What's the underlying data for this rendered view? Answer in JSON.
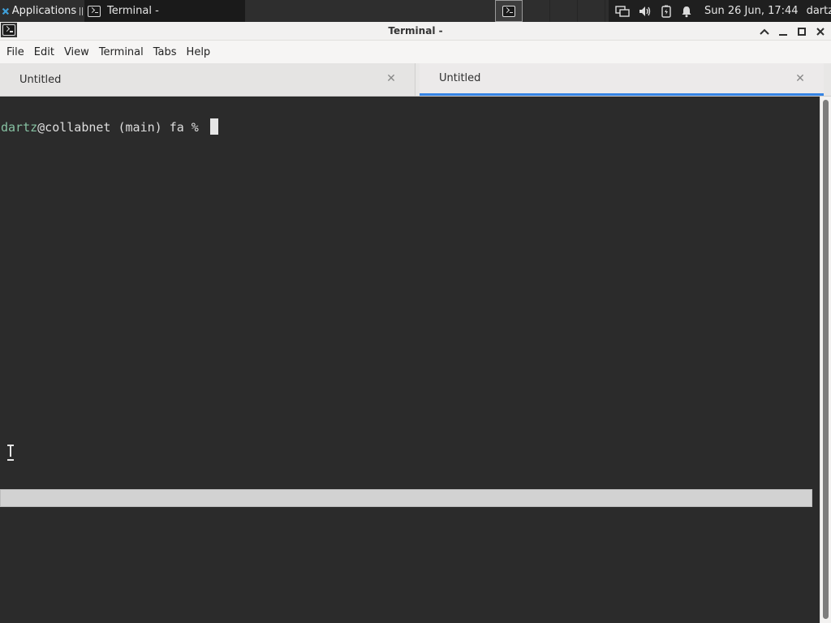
{
  "panel": {
    "applications_label": "Applications",
    "taskbar_window_label": "Terminal -",
    "clock": "Sun 26 Jun, 17:44",
    "user": "dartz"
  },
  "window": {
    "title": "Terminal -"
  },
  "menu": {
    "items": [
      "File",
      "Edit",
      "View",
      "Terminal",
      "Tabs",
      "Help"
    ]
  },
  "tabs": [
    {
      "label": "Untitled",
      "active": false
    },
    {
      "label": "Untitled",
      "active": true
    }
  ],
  "terminal": {
    "prompt_user": "dartz",
    "prompt_rest": "@collabnet (main) fa % "
  },
  "colors": {
    "accent": "#3584e4",
    "prompt_user": "#86c1a2",
    "terminal_bg": "#2b2b2b"
  },
  "icons": {
    "apps": "applications-logo-icon",
    "terminal": "terminal-icon",
    "network": "network-icon",
    "volume": "volume-icon",
    "battery": "battery-icon",
    "notifications": "bell-icon"
  }
}
